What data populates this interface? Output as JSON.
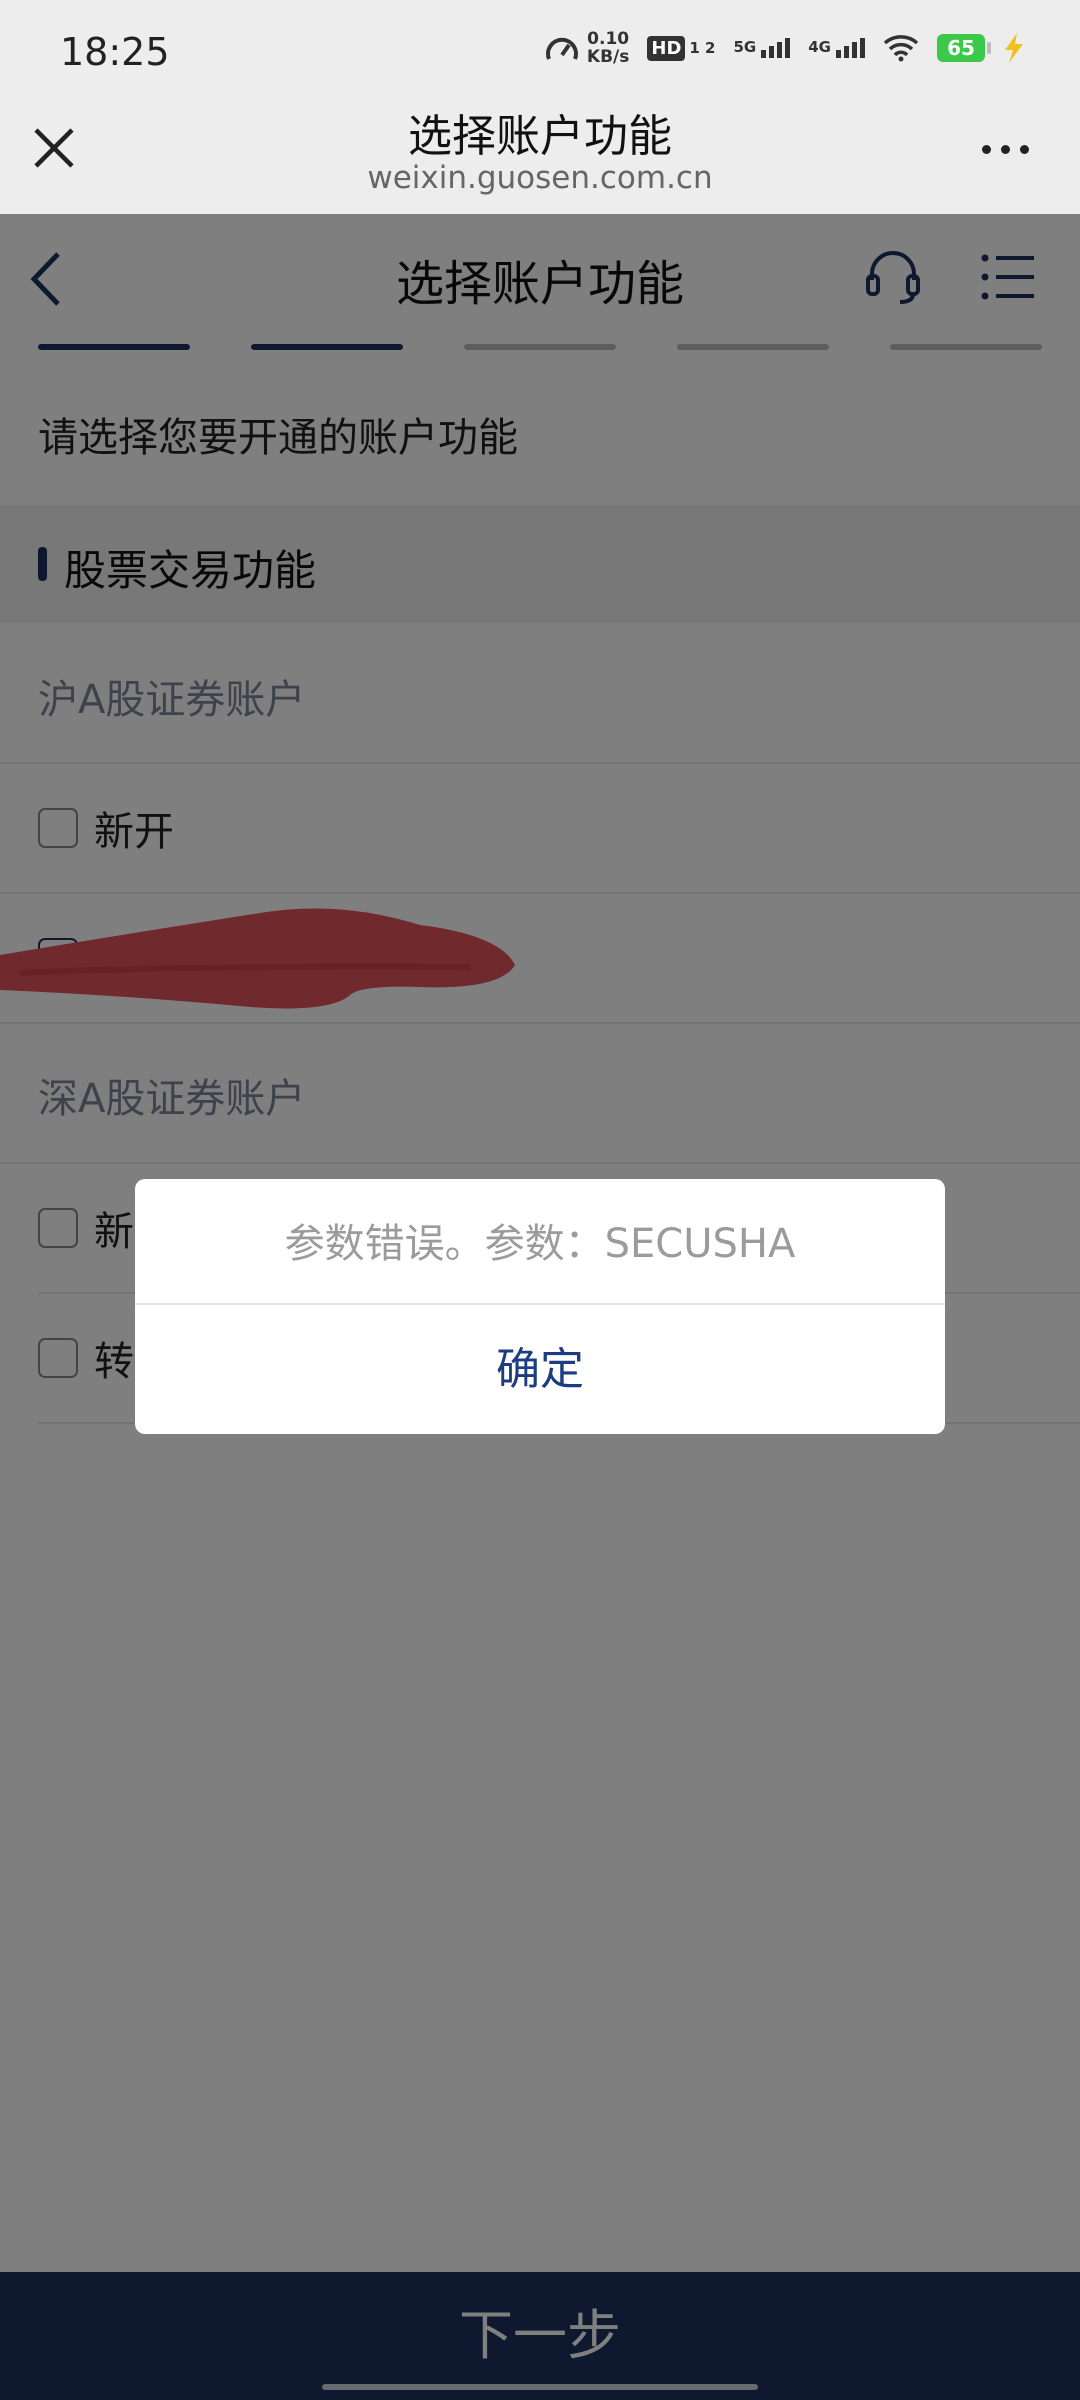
{
  "status_bar": {
    "time": "18:25",
    "net_speed_value": "0.10",
    "net_speed_unit": "KB/s",
    "hd_label": "HD",
    "sim_labels": "1 2",
    "signal_5g": "5G",
    "signal_4g": "4G",
    "battery": "65"
  },
  "webview": {
    "title": "选择账户功能",
    "domain": "weixin.guosen.com.cn"
  },
  "app_header": {
    "title": "选择账户功能"
  },
  "progress_steps": [
    {
      "state": "done"
    },
    {
      "state": "current"
    },
    {
      "state": "pending"
    },
    {
      "state": "pending"
    },
    {
      "state": "pending"
    }
  ],
  "instruction": "请选择您要开通的账户功能",
  "section": {
    "title": "股票交易功能"
  },
  "groups": [
    {
      "title": "沪A股证券账户",
      "options": [
        "新开"
      ]
    },
    {
      "title": "深A股证券账户",
      "options": [
        "新",
        "转"
      ]
    }
  ],
  "footer": {
    "next_label": "下一步"
  },
  "dialog": {
    "message": "参数错误。参数：SECUSHA",
    "confirm_label": "确定"
  },
  "colors": {
    "brand": "#1c3260",
    "dialog_button": "#1c3e80",
    "mask": "rgba(0,0,0,0.5)",
    "redaction": "#e0525a"
  }
}
